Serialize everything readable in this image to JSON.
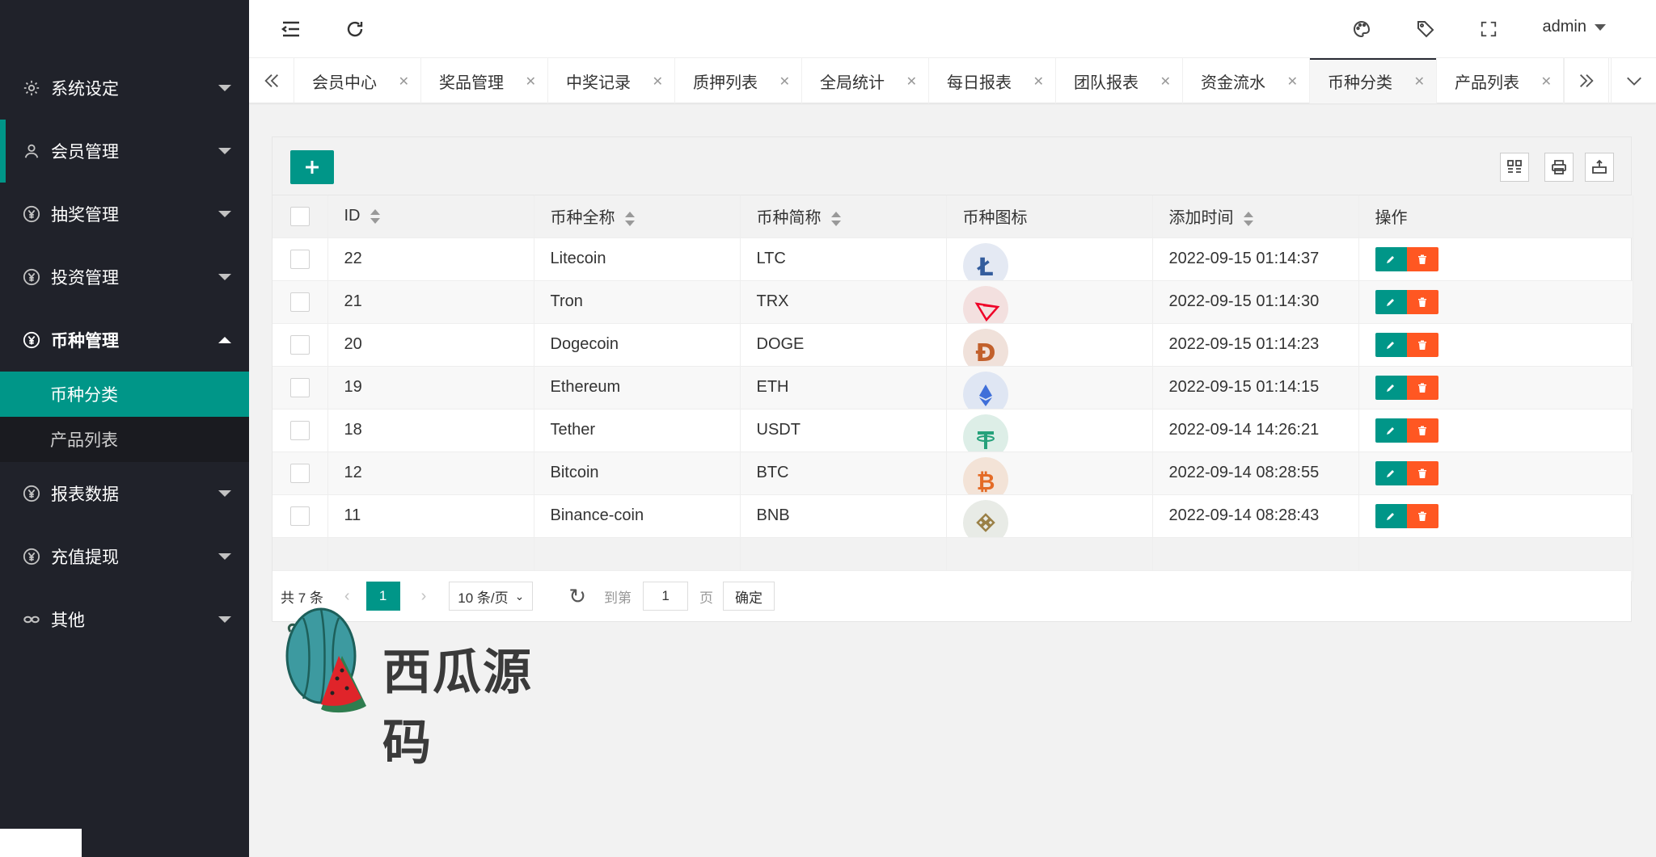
{
  "sidebar": {
    "items": [
      {
        "label": "系统设定",
        "icon": "gear-icon"
      },
      {
        "label": "会员管理",
        "icon": "user-icon"
      },
      {
        "label": "抽奖管理",
        "icon": "yen-circle-icon"
      },
      {
        "label": "投资管理",
        "icon": "yen-circle-icon"
      },
      {
        "label": "币种管理",
        "icon": "yen-circle-icon"
      },
      {
        "label": "报表数据",
        "icon": "yen-circle-icon"
      },
      {
        "label": "充值提现",
        "icon": "yen-circle-icon"
      },
      {
        "label": "其他",
        "icon": "link-icon"
      }
    ],
    "subitems": [
      {
        "label": "币种分类"
      },
      {
        "label": "产品列表"
      }
    ]
  },
  "header": {
    "user": "admin",
    "icons": [
      "menu-fold-icon",
      "refresh-icon",
      "palette-icon",
      "tag-icon",
      "fullscreen-icon"
    ]
  },
  "tabs": [
    {
      "label": "会员中心"
    },
    {
      "label": "奖品管理"
    },
    {
      "label": "中奖记录"
    },
    {
      "label": "质押列表"
    },
    {
      "label": "全局统计"
    },
    {
      "label": "每日报表"
    },
    {
      "label": "团队报表"
    },
    {
      "label": "资金流水"
    },
    {
      "label": "币种分类"
    },
    {
      "label": "产品列表"
    }
  ],
  "table": {
    "columns": [
      "ID",
      "币种全称",
      "币种简称",
      "币种图标",
      "添加时间",
      "操作"
    ],
    "rows": [
      {
        "id": "22",
        "name": "Litecoin",
        "symbol": "LTC",
        "time": "2022-09-15 01:14:37",
        "icon_color": "#345d9d"
      },
      {
        "id": "21",
        "name": "Tron",
        "symbol": "TRX",
        "time": "2022-09-15 01:14:30",
        "icon_color": "#ef0027"
      },
      {
        "id": "20",
        "name": "Dogecoin",
        "symbol": "DOGE",
        "time": "2022-09-15 01:14:23",
        "icon_color": "#c3a634"
      },
      {
        "id": "19",
        "name": "Ethereum",
        "symbol": "ETH",
        "time": "2022-09-15 01:14:15",
        "icon_color": "#627eea"
      },
      {
        "id": "18",
        "name": "Tether",
        "symbol": "USDT",
        "time": "2022-09-14 14:26:21",
        "icon_color": "#26a17b"
      },
      {
        "id": "12",
        "name": "Bitcoin",
        "symbol": "BTC",
        "time": "2022-09-14 08:28:55",
        "icon_color": "#f7931a"
      },
      {
        "id": "11",
        "name": "Binance-coin",
        "symbol": "BNB",
        "time": "2022-09-14 08:28:43",
        "icon_color": "#f3ba2f"
      }
    ]
  },
  "pager": {
    "total": "共 7 条",
    "current": "1",
    "size": "10 条/页",
    "goto_label": "到第",
    "goto_value": "1",
    "page_label": "页",
    "confirm": "确定"
  },
  "watermark": {
    "text": "西瓜源码"
  },
  "colors": {
    "accent": "#009688",
    "danger": "#ff5722",
    "sidebar": "#20222a"
  }
}
